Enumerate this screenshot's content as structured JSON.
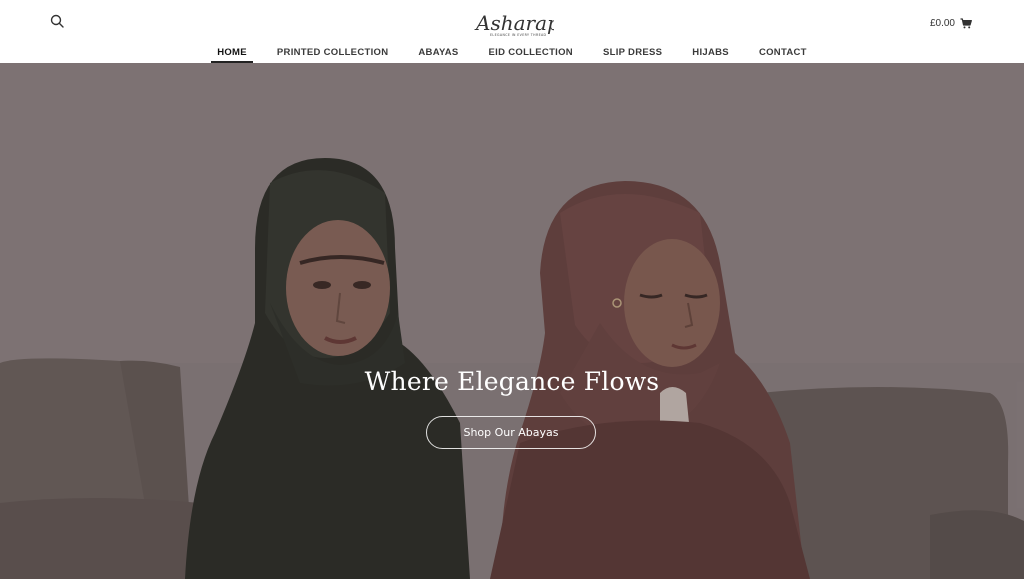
{
  "header": {
    "logo_text": "Asharap",
    "logo_tagline": "ELEGANCE IN EVERY THREAD",
    "cart_total": "£0.00"
  },
  "nav": {
    "items": [
      {
        "label": "HOME",
        "active": true
      },
      {
        "label": "PRINTED COLLECTION",
        "active": false
      },
      {
        "label": "ABAYAS",
        "active": false
      },
      {
        "label": "EID COLLECTION",
        "active": false
      },
      {
        "label": "SLIP DRESS",
        "active": false
      },
      {
        "label": "HIJABS",
        "active": false
      },
      {
        "label": "CONTACT",
        "active": false
      }
    ]
  },
  "hero": {
    "title": "Where Elegance Flows",
    "button_label": "Shop Our Abayas"
  },
  "icons": {
    "search": "search-icon",
    "cart": "cart-icon"
  }
}
